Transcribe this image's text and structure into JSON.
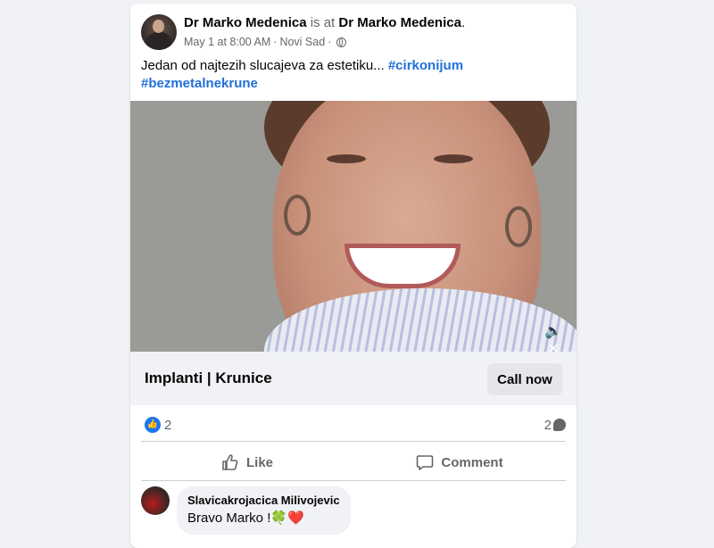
{
  "post": {
    "author": "Dr Marko Medenica",
    "at_text": "is at",
    "location_name": "Dr Marko Medenica",
    "timestamp": "May 1 at 8:00 AM",
    "place": "Novi Sad",
    "caption_text": "Jedan od najtezih slucajeva za estetiku...",
    "hashtags": [
      "#cirkonijum",
      "#bezmetalnekrune"
    ],
    "audience_icon": "globe-icon"
  },
  "cta": {
    "title": "Implanti | Krunice",
    "button_label": "Call now"
  },
  "video": {
    "mute_icon": "speaker-muted-icon"
  },
  "stats": {
    "reaction_count": "2",
    "comment_count": "2"
  },
  "actions": {
    "like_label": "Like",
    "comment_label": "Comment"
  },
  "comments": [
    {
      "author": "Slavicakrojacica Milivojevic",
      "text": "Bravo Marko !",
      "emojis": [
        "🍀",
        "❤️"
      ]
    }
  ],
  "colors": {
    "background": "#f0f2f5",
    "card": "#ffffff",
    "link": "#216fdb",
    "muted": "#65676b",
    "like_blue": "#1877f2"
  }
}
